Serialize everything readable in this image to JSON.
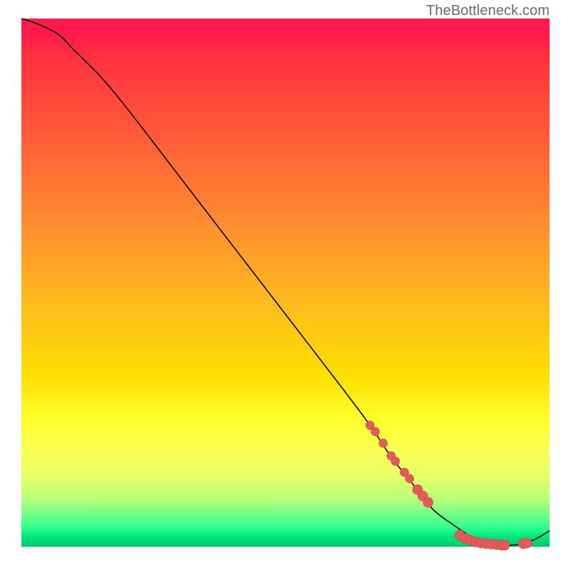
{
  "watermark": "TheBottleneck.com",
  "colors": {
    "dot_fill": "#e55a5a",
    "dot_stroke": "#c74848",
    "curve": "#000000"
  },
  "chart_data": {
    "type": "line",
    "title": "",
    "xlabel": "",
    "ylabel": "",
    "xlim": [
      0,
      100
    ],
    "ylim": [
      0,
      100
    ],
    "series": [
      {
        "name": "bottleneck_curve",
        "x": [
          0,
          3,
          7,
          10,
          15,
          20,
          30,
          40,
          50,
          60,
          66,
          70,
          74,
          78,
          82,
          85,
          88,
          91,
          94,
          97,
          100
        ],
        "y": [
          100,
          99,
          97,
          94,
          89,
          83,
          70,
          57,
          44,
          31,
          23,
          17,
          12,
          7,
          4,
          2,
          0.6,
          0.3,
          0.4,
          1.3,
          3
        ]
      }
    ],
    "markers": {
      "name": "highlighted_points",
      "x": [
        66,
        67,
        68.5,
        70,
        70.8,
        72.5,
        73.5,
        75,
        76,
        77,
        83,
        84,
        85,
        86,
        87,
        88,
        89,
        90,
        91,
        91.5,
        95,
        95.7
      ],
      "y": [
        23,
        21.8,
        19.6,
        17.2,
        16.2,
        14.1,
        12.9,
        10.8,
        9.6,
        8.4,
        2.2,
        1.6,
        1.2,
        0.9,
        0.7,
        0.6,
        0.5,
        0.4,
        0.3,
        0.3,
        0.6,
        0.7
      ],
      "r": [
        6,
        6,
        6,
        6,
        6,
        6,
        6,
        7,
        7,
        7,
        7,
        7,
        7,
        7,
        7,
        7,
        7,
        7,
        7,
        7,
        7,
        7
      ]
    }
  }
}
